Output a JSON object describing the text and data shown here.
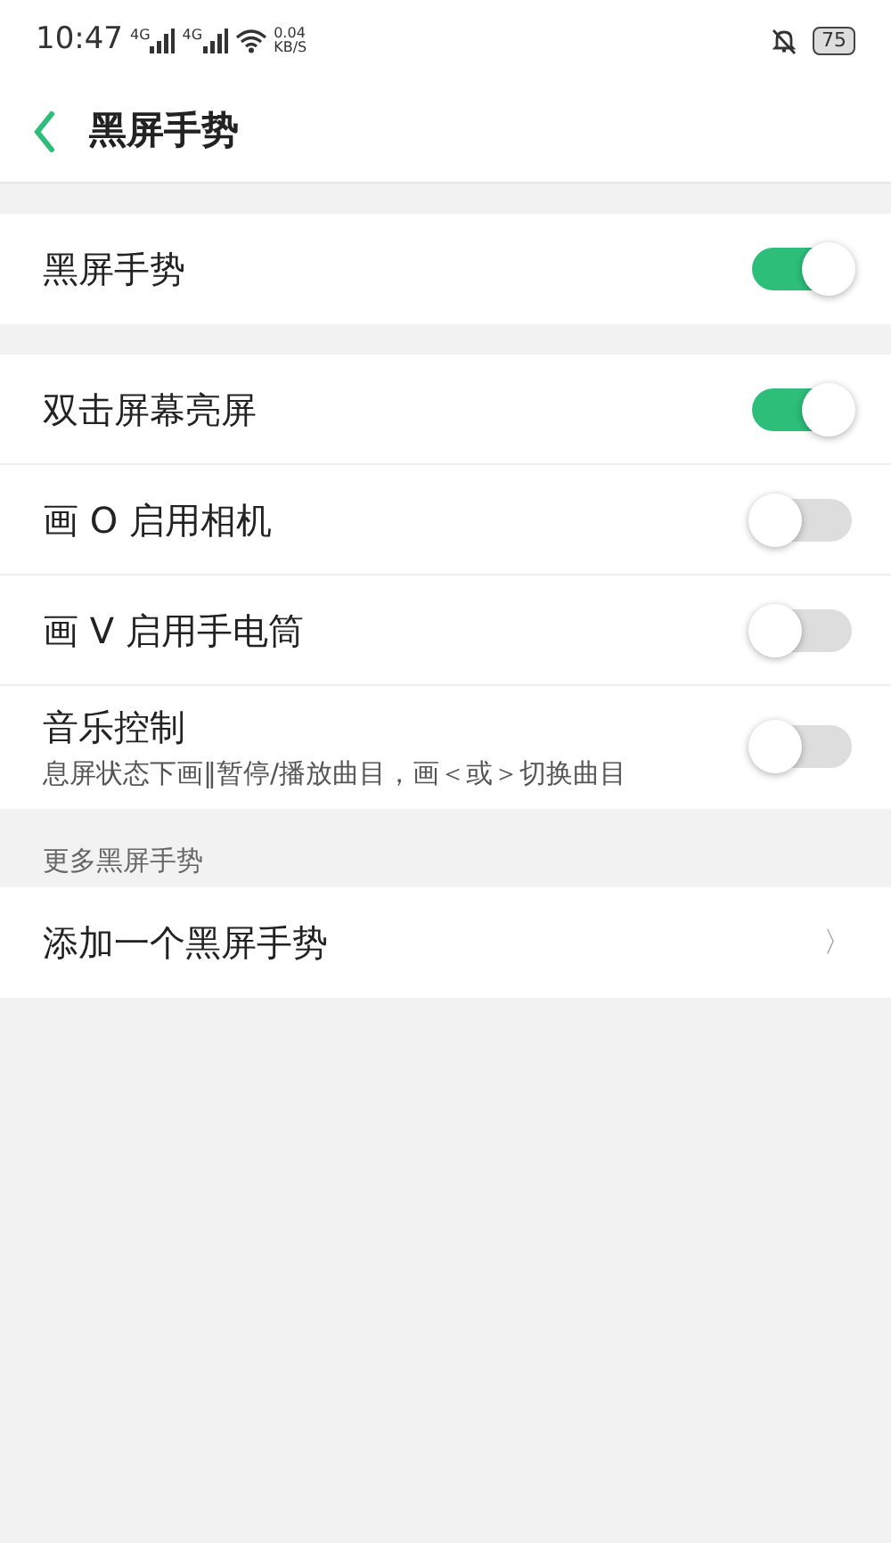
{
  "status_bar": {
    "time": "10:47",
    "network_1": "4G",
    "network_2": "4G",
    "speed_value": "0.04",
    "speed_unit": "KB/S",
    "battery": "75"
  },
  "header": {
    "title": "黑屏手势"
  },
  "groups": [
    {
      "items": [
        {
          "kind": "toggle",
          "label": "黑屏手势",
          "on": true
        }
      ]
    },
    {
      "items": [
        {
          "kind": "toggle",
          "label": "双击屏幕亮屏",
          "on": true
        },
        {
          "kind": "toggle",
          "label": "画 O 启用相机",
          "on": false
        },
        {
          "kind": "toggle",
          "label": "画 V 启用手电筒",
          "on": false
        },
        {
          "kind": "toggle",
          "label": "音乐控制",
          "description": "息屏状态下画‖暂停/播放曲目，画＜或＞切换曲目",
          "on": false
        }
      ]
    },
    {
      "title": "更多黑屏手势",
      "items": [
        {
          "kind": "link",
          "label": "添加一个黑屏手势",
          "chevron": "〉"
        }
      ]
    }
  ]
}
